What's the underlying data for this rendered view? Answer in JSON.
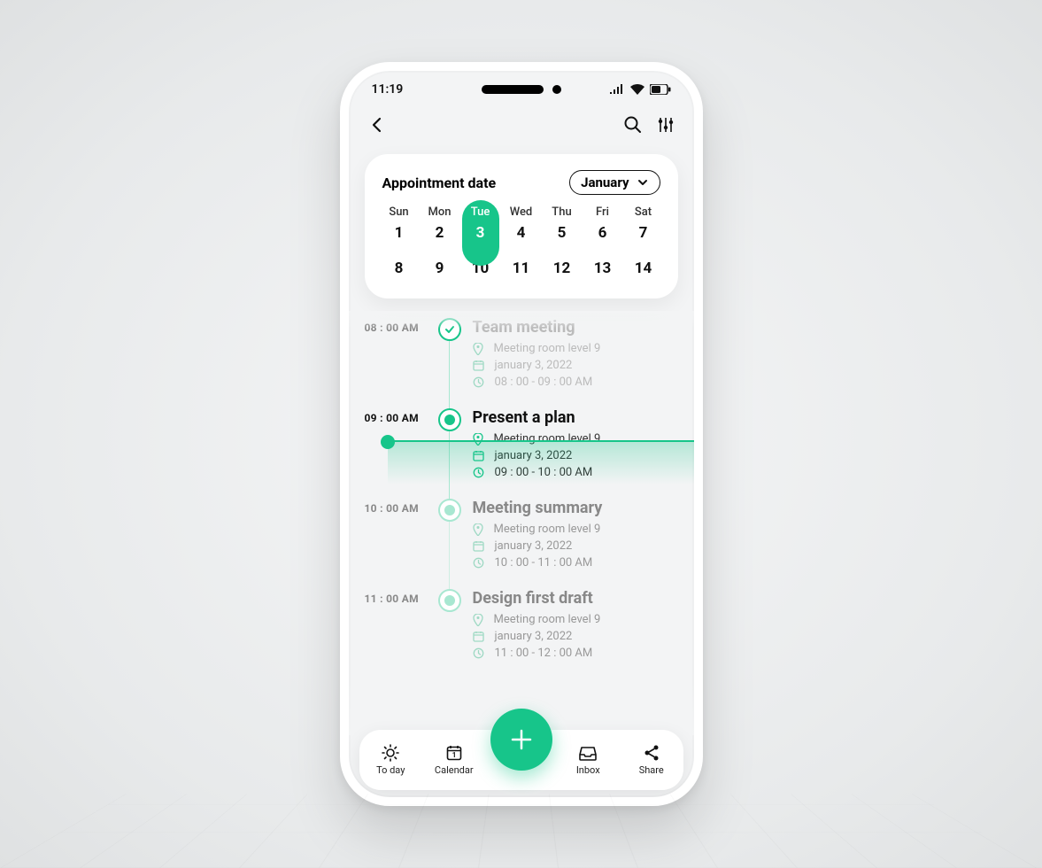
{
  "status": {
    "time": "11:19"
  },
  "calendarCard": {
    "title": "Appointment date",
    "month": "January",
    "daysOfWeek": [
      "Sun",
      "Mon",
      "Tue",
      "Wed",
      "Thu",
      "Fri",
      "Sat"
    ],
    "row1": [
      "1",
      "2",
      "3",
      "4",
      "5",
      "6",
      "7"
    ],
    "row2": [
      "8",
      "9",
      "10",
      "11",
      "12",
      "13",
      "14"
    ],
    "selectedIndex": 2
  },
  "timeline": [
    {
      "time": "08 : 00 AM",
      "title": "Team meeting",
      "location": "Meeting room level 9",
      "date": "january 3, 2022",
      "range": "08 : 00 - 09 : 00 AM",
      "state": "done"
    },
    {
      "time": "09 : 00 AM",
      "title": "Present a plan",
      "location": "Meeting room level 9",
      "date": "january 3, 2022",
      "range": "09 : 00 - 10 : 00 AM",
      "state": "active"
    },
    {
      "time": "10 : 00 AM",
      "title": "Meeting summary",
      "location": "Meeting room level 9",
      "date": "january 3, 2022",
      "range": "10 : 00 - 11 : 00 AM",
      "state": "upcoming"
    },
    {
      "time": "11 : 00 AM",
      "title": "Design first draft",
      "location": "Meeting room level 9",
      "date": "january 3, 2022",
      "range": "11 : 00 - 12 : 00 AM",
      "state": "upcoming"
    }
  ],
  "bottomNav": {
    "items": [
      {
        "label": "To day",
        "icon": "sun"
      },
      {
        "label": "Calendar",
        "icon": "calendar"
      },
      {
        "label": "Inbox",
        "icon": "inbox"
      },
      {
        "label": "Share",
        "icon": "share"
      }
    ]
  },
  "colors": {
    "accent": "#17c58a"
  }
}
